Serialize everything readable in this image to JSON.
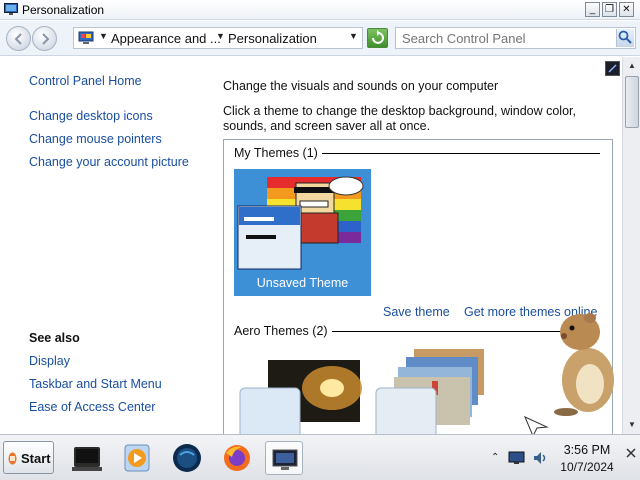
{
  "window": {
    "title": "Personalization"
  },
  "address": {
    "crumbs": [
      "Appearance and ...",
      "Personalization"
    ],
    "search_placeholder": "Search Control Panel"
  },
  "sidebar": {
    "home": "Control Panel Home",
    "links": [
      "Change desktop icons",
      "Change mouse pointers",
      "Change your account picture"
    ],
    "see_also_heading": "See also",
    "see_also": [
      "Display",
      "Taskbar and Start Menu",
      "Ease of Access Center"
    ]
  },
  "main": {
    "heading": "Change the visuals and sounds on your computer",
    "description": "Click a theme to change the desktop background, window color, sounds, and screen saver all at once.",
    "my_themes": "My Themes (1)",
    "selected_theme": "Unsaved Theme",
    "save_theme": "Save theme",
    "get_more_themes": "Get more themes online",
    "aero_themes": "Aero Themes (2)"
  },
  "taskbar": {
    "start": "Start",
    "apps": [
      "terminal-icon",
      "media-player-icon",
      "globe-icon",
      "firefox-icon",
      "personalization-icon"
    ],
    "time": "3:56 PM",
    "date": "10/7/2024"
  },
  "colors": {
    "link": "#1a4fa0",
    "selection": "#3d8fd6",
    "taskbar": "#dfe2e7"
  }
}
